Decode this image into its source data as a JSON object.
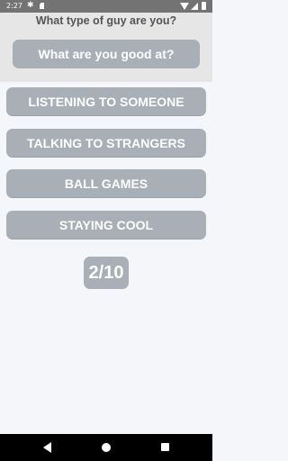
{
  "status_bar": {
    "time": "2:27",
    "icons": [
      "settings-icon",
      "sd-card-icon",
      "wifi-icon",
      "signal-icon",
      "battery-icon"
    ]
  },
  "header": {
    "title": "What type of guy are you?",
    "question": "What are you good at?"
  },
  "answers": [
    "LISTENING TO SOMEONE",
    "TALKING TO STRANGERS",
    "BALL GAMES",
    "STAYING COOL"
  ],
  "progress": {
    "label": "2/10",
    "current": 2,
    "total": 10
  },
  "nav_bar": {
    "icons": [
      "back-icon",
      "home-icon",
      "recents-icon"
    ]
  },
  "colors": {
    "button": "#a9afb6",
    "header_bg": "#e6e6e6",
    "page_bg": "#f4f6f9",
    "status_bar": "#737373"
  }
}
